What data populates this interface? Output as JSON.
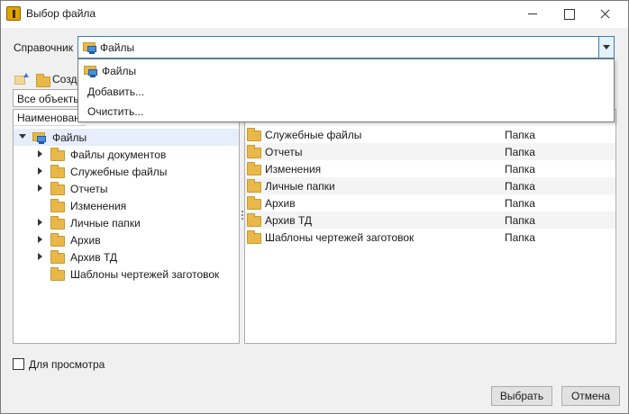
{
  "window": {
    "title": "Выбор файла"
  },
  "reference": {
    "label": "Справочник",
    "value": "Файлы"
  },
  "toolbar": {
    "create_label": "Созд",
    "filter_value": "Все объекты"
  },
  "dropdown": {
    "items": [
      {
        "label": "Файлы",
        "icon": "files-icon"
      },
      {
        "label": "Добавить..."
      },
      {
        "label": "Очистить..."
      }
    ]
  },
  "tree": {
    "header": "Наименован",
    "root": {
      "label": "Файлы",
      "expanded": true,
      "icon": "files-icon"
    },
    "items": [
      {
        "label": "Файлы документов",
        "expandable": true
      },
      {
        "label": "Служебные файлы",
        "expandable": true
      },
      {
        "label": "Отчеты",
        "expandable": true
      },
      {
        "label": "Изменения",
        "expandable": false
      },
      {
        "label": "Личные папки",
        "expandable": true
      },
      {
        "label": "Архив",
        "expandable": true
      },
      {
        "label": "Архив ТД",
        "expandable": true
      },
      {
        "label": "Шаблоны чертежей заготовок",
        "expandable": false
      }
    ]
  },
  "list": {
    "rows": [
      {
        "name": "Служебные файлы",
        "type": "Папка"
      },
      {
        "name": "Отчеты",
        "type": "Папка"
      },
      {
        "name": "Изменения",
        "type": "Папка"
      },
      {
        "name": "Личные папки",
        "type": "Папка"
      },
      {
        "name": "Архив",
        "type": "Папка"
      },
      {
        "name": "Архив ТД",
        "type": "Папка"
      },
      {
        "name": "Шаблоны чертежей заготовок",
        "type": "Папка"
      }
    ]
  },
  "footer": {
    "preview_label": "Для просмотра",
    "preview_checked": false,
    "ok_label": "Выбрать",
    "cancel_label": "Отмена"
  },
  "colors": {
    "accent": "#3c7fb1",
    "folder": "#e8b84a",
    "selection": "#e5eefa"
  }
}
